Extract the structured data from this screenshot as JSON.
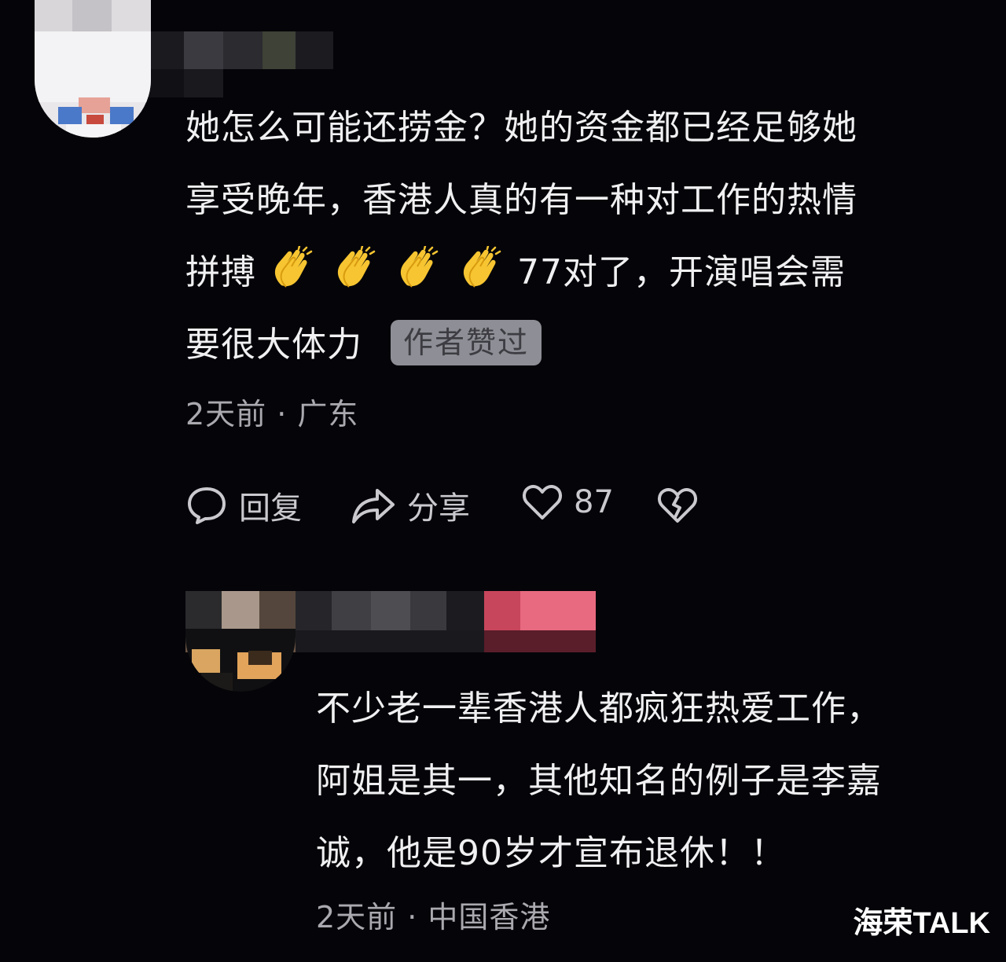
{
  "comment1": {
    "lines": [
      "她怎么可能还捞金？她的资金都已经足够她",
      "享受晚年，香港人真的有一种对工作的热情"
    ],
    "line3_prefix": "拼搏",
    "line3_suffix": "77对了，开演唱会需",
    "line4": "要很大体力",
    "emoji": [
      "clap-emoji",
      "clap-emoji",
      "clap-emoji",
      "clap-emoji"
    ],
    "author_badge": "作者赞过",
    "meta": "2天前 · 广东",
    "actions": {
      "reply_label": "回复",
      "share_label": "分享",
      "like_count": "87"
    }
  },
  "comment2": {
    "lines": [
      "不少老一辈香港人都疯狂热爱工作，",
      "阿姐是其一，其他知名的例子是李嘉",
      "诚，他是90岁才宣布退休！！"
    ],
    "meta": "2天前 · 中国香港"
  },
  "watermark": "海荣TALK",
  "colors": {
    "background": "#050509",
    "text": "#f0f0f2",
    "meta_text": "#a9a9af",
    "badge_bg": "#8e8e96",
    "badge_text": "#3c3c42",
    "emoji_yellow": "#f7c531"
  },
  "icons": {
    "reply": "comment-bubble-icon",
    "share": "share-arrow-icon",
    "like": "heart-outline-icon",
    "dislike": "broken-heart-icon"
  }
}
